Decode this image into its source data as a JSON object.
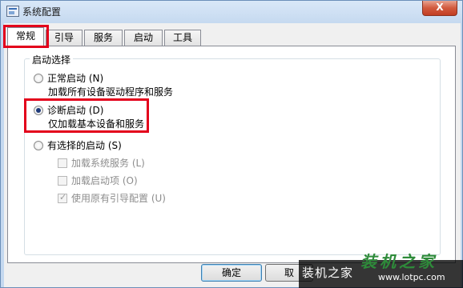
{
  "window": {
    "title": "系统配置",
    "close_label": "X"
  },
  "tabs": [
    {
      "label": "常规",
      "active": true
    },
    {
      "label": "引导",
      "active": false
    },
    {
      "label": "服务",
      "active": false
    },
    {
      "label": "启动",
      "active": false
    },
    {
      "label": "工具",
      "active": false
    }
  ],
  "startup": {
    "group_title": "启动选择",
    "normal": {
      "label": "正常启动 (N)",
      "desc": "加载所有设备驱动程序和服务",
      "checked": false
    },
    "diagnostic": {
      "label": "诊断启动 (D)",
      "desc": "仅加载基本设备和服务",
      "checked": true
    },
    "selective": {
      "label": "有选择的启动 (S)",
      "checked": false
    },
    "options": [
      {
        "label": "加载系统服务 (L)",
        "checked": false
      },
      {
        "label": "加载启动项 (O)",
        "checked": false
      },
      {
        "label": "使用原有引导配置 (U)",
        "checked": true
      }
    ]
  },
  "buttons": {
    "ok": "确定",
    "cancel": "取"
  },
  "watermark": {
    "text": "装机之家",
    "logo": "装机之家",
    "url": "www.lotpc.com"
  },
  "colors": {
    "highlight": "#e3001b"
  }
}
